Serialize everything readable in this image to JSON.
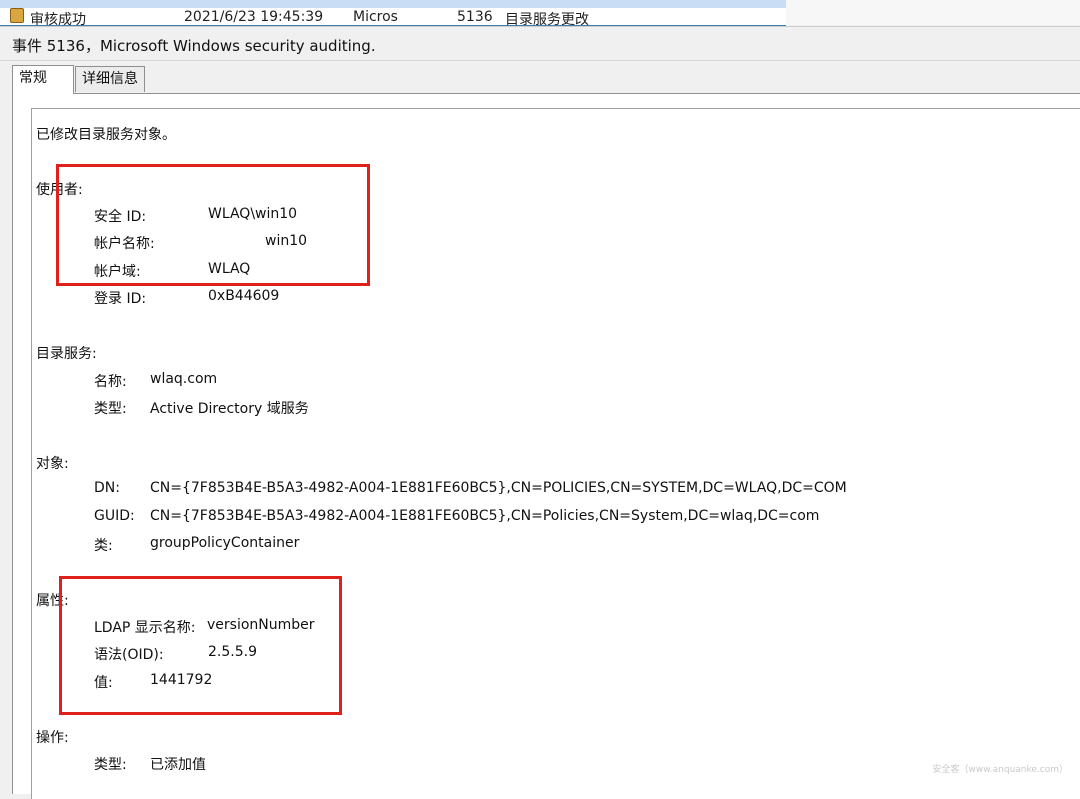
{
  "list_row": {
    "status": "审核成功",
    "datetime": "2021/6/23 19:45:39",
    "source": "Micros",
    "event_id": "5136",
    "category": "目录服务更改"
  },
  "window_title": "事件 5136，Microsoft Windows security auditing.",
  "tabs": [
    {
      "label": "常规",
      "active": true
    },
    {
      "label": "详细信息",
      "active": false
    }
  ],
  "event": {
    "summary": "已修改目录服务对象。",
    "subject": {
      "header": "使用者:",
      "security_id_label": "安全 ID:",
      "security_id_value": "WLAQ\\win10",
      "account_name_label": "帐户名称:",
      "account_name_value": "win10",
      "account_domain_label": "帐户域:",
      "account_domain_value": "WLAQ",
      "logon_id_label": "登录 ID:",
      "logon_id_value": "0xB44609"
    },
    "directory_service": {
      "header": "目录服务:",
      "name_label": "名称:",
      "name_value": "wlaq.com",
      "type_label": "类型:",
      "type_value": "Active Directory 域服务"
    },
    "object": {
      "header": "对象:",
      "dn_label": "DN:",
      "dn_value": "CN={7F853B4E-B5A3-4982-A004-1E881FE60BC5},CN=POLICIES,CN=SYSTEM,DC=WLAQ,DC=COM",
      "guid_label": "GUID:",
      "guid_value": "CN={7F853B4E-B5A3-4982-A004-1E881FE60BC5},CN=Policies,CN=System,DC=wlaq,DC=com",
      "class_label": "类:",
      "class_value": "groupPolicyContainer"
    },
    "attribute": {
      "header": "属性:",
      "ldap_label": "LDAP 显示名称:",
      "ldap_value": "versionNumber",
      "syntax_label": "语法(OID):",
      "syntax_value": "2.5.5.9",
      "value_label": "值:",
      "value_value": "1441792"
    },
    "operation": {
      "header": "操作:",
      "type_label": "类型:",
      "type_value": "已添加值"
    }
  },
  "watermark": "安全客（www.anquanke.com）",
  "colors": {
    "highlight_box": "#e0201c",
    "selection": "#c9ddf5"
  }
}
